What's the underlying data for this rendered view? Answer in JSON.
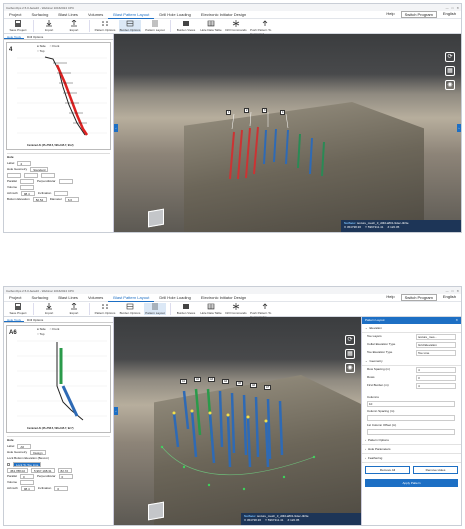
{
  "screenshots": [
    {
      "titlebar": "CarbonOps 2.5.0-beta10 - Webinar 10162024 CPC",
      "menu": [
        "Project",
        "Surfacing",
        "Blast Lines",
        "Volumes",
        "Blast Pattern Layout",
        "Drill Hole Loading",
        "Electronic Initiator Design"
      ],
      "menu_right": [
        "Help",
        "Switch Program",
        "English"
      ],
      "toolbar": [
        "Save Project",
        "Import",
        "Export",
        "Pattern Options",
        "Burden Options",
        "Pattern Layout",
        "Burden Views",
        "Hole Data Table",
        "Drill Commands",
        "Push Pattern To Command"
      ],
      "left_tabs": [
        "Hole Tools",
        "Drill Options"
      ],
      "sideview": {
        "options": [
          "Side",
          "Front",
          "Top"
        ],
        "hole_name": "4",
        "footer": "Centered At (45+758.5, 596+195.7, 93.2)"
      },
      "hole_section": "Hole",
      "fields": {
        "label": "Label",
        "label_value": "4",
        "geometry": "Hole Geometry",
        "geometry_value": "Standard",
        "parallel": "Parallel",
        "perpendicular": "Perpendicular",
        "volume": "Volume",
        "azimuth": "Azimuth",
        "azimuth_value": "98.4",
        "inclination": "Inclination",
        "diameter": "Diameter",
        "diameter_value": "6.0",
        "bottom_elevation": "Bottom Elevation",
        "bottom_value": "82.54"
      },
      "status": {
        "surface_label": "Surface:",
        "surface": "texture_mesh_3_d0b1a801-9dec-4b9e",
        "x": "X 454738.36",
        "y": "Y 5967311.41",
        "z": "Z 120.05"
      }
    },
    {
      "titlebar": "CarbonOps 2.5.0-beta10 - Webinar 10162024 CPC",
      "menu": [
        "Project",
        "Surfacing",
        "Blast Lines",
        "Volumes",
        "Blast Pattern Layout",
        "Drill Hole Loading",
        "Electronic Initiator Design"
      ],
      "menu_right": [
        "Help",
        "Switch Program",
        "English"
      ],
      "toolbar": [
        "Save Project",
        "Import",
        "Export",
        "Pattern Options",
        "Burden Options",
        "Pattern Layout",
        "Burden Views",
        "Hole Data Table",
        "Drill Commands",
        "Push Pattern To Commander"
      ],
      "left_tabs": [
        "Hole Tools",
        "Drill Options"
      ],
      "sideview": {
        "options": [
          "Side",
          "Front",
          "Top"
        ],
        "hole_name": "A6",
        "footer": "Centered At (45+758.5, 596+195.7, 92.7)"
      },
      "hole_section": "Hole",
      "fields": {
        "label": "Label",
        "label_value": "A6",
        "geometry": "Hole Geometry",
        "geometry_value": "Design",
        "collar_elev": "Lock Bottom Elevation (Best-in)",
        "lock_btn": "Lock To Toe Line",
        "x_value": "454,788.02",
        "y_value": "5,967,198.31",
        "z_value": "82.72",
        "parallel": "Parallel",
        "parallel_value": "0",
        "perpendicular": "Perpendicular",
        "perp_value": "0",
        "volume": "Volume",
        "azimuth": "Azimuth",
        "azimuth_value": "98.4",
        "inclination": "Inclination",
        "incl_value": "0"
      },
      "right_panel": {
        "title": "Pattern Layout",
        "elevation": "Elevation",
        "elev_rows": [
          [
            "Toe Layers",
            "texture_mes..."
          ],
          [
            "Collar Elevation Type",
            "Grid Elevation"
          ],
          [
            "Toe Elevation Type",
            "Toe Line"
          ]
        ],
        "geometry": "Geometry",
        "geo_rows": [
          [
            "Row Spacing (m)",
            "4"
          ],
          [
            "Rows",
            "3"
          ],
          [
            "First Burden (m)",
            "4"
          ]
        ],
        "columns": "Columns",
        "col_value": "10",
        "col_rows": [
          "Column Spacing (m)",
          "1st Column Offset (m)"
        ],
        "sections": [
          "Pattern Options",
          "Hole Parameters",
          "Feathering"
        ],
        "remove_all": "Remove All",
        "remove_holes": "Remove Holes",
        "apply": "Apply Pattern"
      },
      "status": {
        "surface_label": "Surface:",
        "surface": "texture_mesh_3_d0b1a801-9dec-4b9e",
        "x": "X 454738.36",
        "y": "Y 5967311.41",
        "z": "Z 120.05"
      }
    }
  ]
}
